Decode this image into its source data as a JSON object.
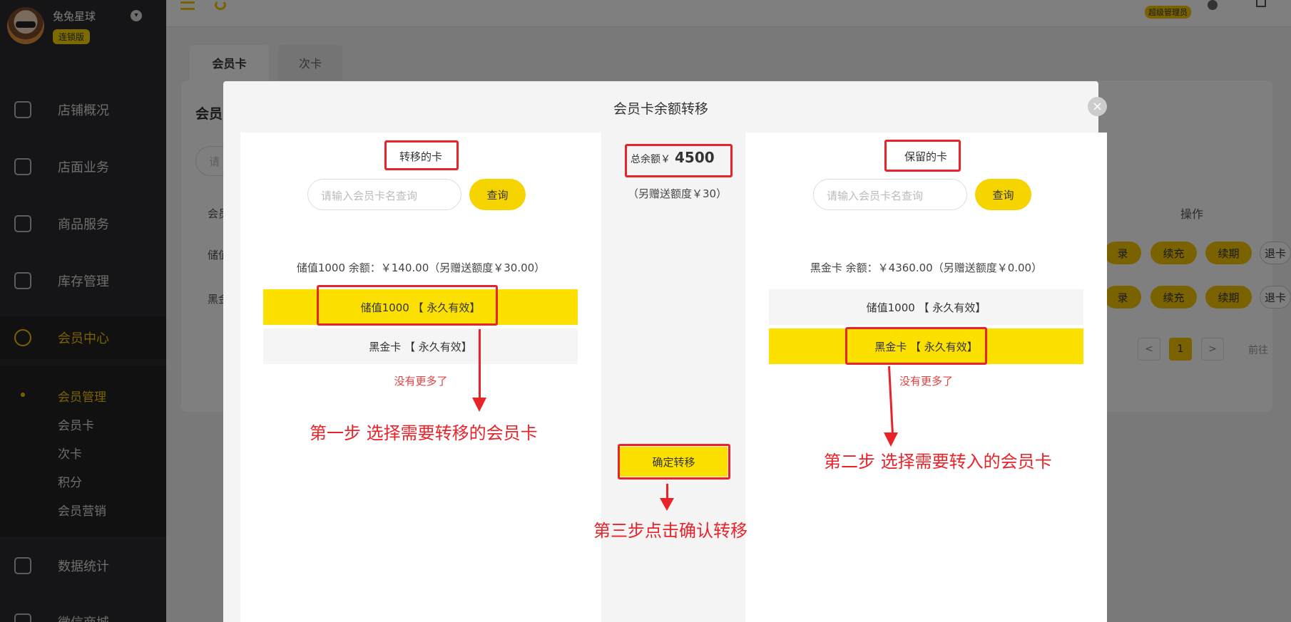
{
  "sidebar": {
    "brand_name": "兔兔星球",
    "brand_badge": "连锁版",
    "items": [
      {
        "label": "店铺概况"
      },
      {
        "label": "店面业务"
      },
      {
        "label": "商品服务"
      },
      {
        "label": "库存管理"
      },
      {
        "label": "会员中心"
      },
      {
        "label": "数据统计"
      },
      {
        "label": "微信商城"
      }
    ],
    "sub_items": [
      {
        "label": "会员管理"
      },
      {
        "label": "会员卡"
      },
      {
        "label": "次卡"
      },
      {
        "label": "积分"
      },
      {
        "label": "会员营销"
      }
    ]
  },
  "topbar": {
    "admin_badge": "超级管理员"
  },
  "background": {
    "tabs": [
      {
        "label": "会员卡"
      },
      {
        "label": "次卡"
      }
    ],
    "section_title": "会员",
    "search_placeholder": "请",
    "col_member": "会员",
    "row1": "储值",
    "row2": "黑金",
    "ops_header": "操作",
    "btn_record": "录",
    "btn_recharge": "续充",
    "btn_renew": "续期",
    "btn_refund": "退卡",
    "pager_prev": "<",
    "pager_page": "1",
    "pager_next": ">",
    "goto_label": "前往"
  },
  "modal": {
    "title": "会员卡余额转移",
    "close": "×",
    "left": {
      "title": "转移的卡",
      "search_placeholder": "请输入会员卡名查询",
      "query_label": "查询",
      "balance": "储值1000 余额：￥140.00（另赠送额度￥30.00）",
      "cards": [
        {
          "label": "储值1000 【 永久有效】",
          "selected": true
        },
        {
          "label": "黑金卡 【 永久有效】",
          "selected": false
        }
      ],
      "no_more": "没有更多了"
    },
    "middle": {
      "total_label": "总余额￥",
      "total_value": "4500",
      "gift": "（另赠送额度￥30）",
      "confirm_label": "确定转移"
    },
    "right": {
      "title": "保留的卡",
      "search_placeholder": "请输入会员卡名查询",
      "query_label": "查询",
      "balance": "黑金卡 余额：￥4360.00（另赠送额度￥0.00）",
      "cards": [
        {
          "label": "储值1000 【 永久有效】",
          "selected": false
        },
        {
          "label": "黑金卡 【 永久有效】",
          "selected": true
        }
      ],
      "no_more": "没有更多了"
    }
  },
  "annotations": {
    "step1": "第一步  选择需要转移的会员卡",
    "step2": "第二步 选择需要转入的会员卡",
    "step3": "第三步点击确认转移"
  },
  "colors": {
    "accent": "#fce000",
    "annotation": "#e8232a",
    "sidebar": "#2a2a2e"
  }
}
